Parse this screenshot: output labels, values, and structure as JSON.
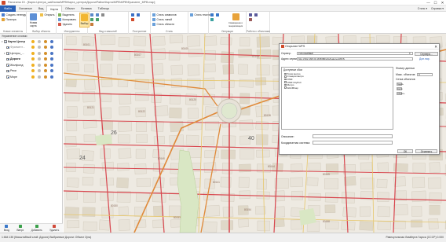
{
  "window": {
    "title": "Panorama 15 - [Карта Центра_шаблоны\\МРВ\\Карта_центра\\Дороги\\Район\\Карта\\МРВ\\МРВ\\Фрагмент_МРВ.map]",
    "controls": [
      "—",
      "☐",
      "✕"
    ]
  },
  "ribbon_tabs": {
    "file": "Файл",
    "tabs": [
      "Основные",
      "Вид",
      "Карта",
      "Объект",
      "Вставка",
      "Таблица"
    ],
    "active_index": 2,
    "right": [
      "Стиль ▾",
      "Справка ▾"
    ]
  },
  "ribbon": {
    "g1": {
      "items": [
        "Создать легенду",
        "Палитра"
      ],
      "name": "Новые элементы"
    },
    "g2": {
      "big": "Новая карта",
      "small": "Открыть",
      "name": "Выбор объекта"
    },
    "g3": {
      "big": "Выбор",
      "items": [
        "Выделить",
        "Копировать",
        "Удалить"
      ],
      "name": "Инструменты"
    },
    "g4": {
      "name": "Вид и масштаб"
    },
    "g5": {
      "name": "Построение"
    },
    "g6": {
      "items": [
        "Стиль символов",
        "Стиль линий",
        "Стиль области"
      ],
      "name": "Стиль"
    },
    "g7": {
      "items": [
        "Стиль текста"
      ],
      "name": ""
    },
    "g8": {
      "big": "Совмещение и генерализация",
      "name": "Операции"
    },
    "g9": {
      "name": "Работа с объектами"
    }
  },
  "layers_panel": {
    "title": "Управление слоями",
    "layers": [
      {
        "name": "Карта Центра_...",
        "bold": true,
        "level": 0,
        "checked": true
      },
      {
        "name": "Фрагмент...",
        "bold": false,
        "level": 1,
        "checked": true,
        "muted": true
      },
      {
        "name": "Центры_...",
        "bold": false,
        "level": 1,
        "checked": true
      },
      {
        "name": "Дороги",
        "bold": true,
        "level": 1,
        "checked": true
      },
      {
        "name": "Жилфонд",
        "bold": false,
        "level": 1,
        "checked": true
      },
      {
        "name": "Реки",
        "bold": false,
        "level": 1,
        "checked": true
      },
      {
        "name": "Море",
        "bold": false,
        "level": 1,
        "checked": true
      }
    ],
    "bottom_buttons": [
      "Вход",
      "Вверх",
      "Добавить",
      "Удалить"
    ]
  },
  "dialog": {
    "title": "Открытие WFS",
    "server_label": "Сервер:",
    "server_value": "ГИС\\СЕРВЕР",
    "server_button": "Сервера...",
    "addr_label": "Адрес сервиса:",
    "addr_value": "http://192.168.30.18:8080/wfs/features/WFS",
    "dop_button": "Доп.пар.",
    "available_title": "Доступные сбои",
    "available_items": [
      "Точки метро",
      "Станции метро",
      "OSM",
      "OSM CityPoll",
      "Метро",
      "WebMGap"
    ],
    "filter_title": "Фильтр данных",
    "max_label": "Макс. объектов:",
    "max_value": "0",
    "area_label": "Сетка объектов",
    "area_buttons": [
      "Задать",
      "Карта",
      "Область"
    ],
    "desc_label": "Описание:",
    "crs_label": "Координатная система:",
    "ok": "ОК",
    "cancel": "Отменить"
  },
  "map_labels": [
    "80101",
    "80107",
    "80105",
    "80104",
    "80110",
    "80117",
    "80120",
    "80121",
    "80122",
    "80125",
    "80126",
    "80123",
    "40",
    "26",
    "24",
    "80140",
    "80141",
    "80144",
    "80145",
    "80150",
    "80153",
    "80154",
    "80158"
  ],
  "statusbar": {
    "left": "1:664 135 (Масштабный слой: Дороги) Выбранные Дороги: Объект 2(на)",
    "right": "Равноугольная Ламберта Гаусса (СССР)  0.000"
  },
  "colors": {
    "accent": "#2b62b8",
    "map_bg": "#eeeae2",
    "road_red": "#d8464e",
    "road_orange": "#e08a3a",
    "block": "#e7e2d8"
  }
}
